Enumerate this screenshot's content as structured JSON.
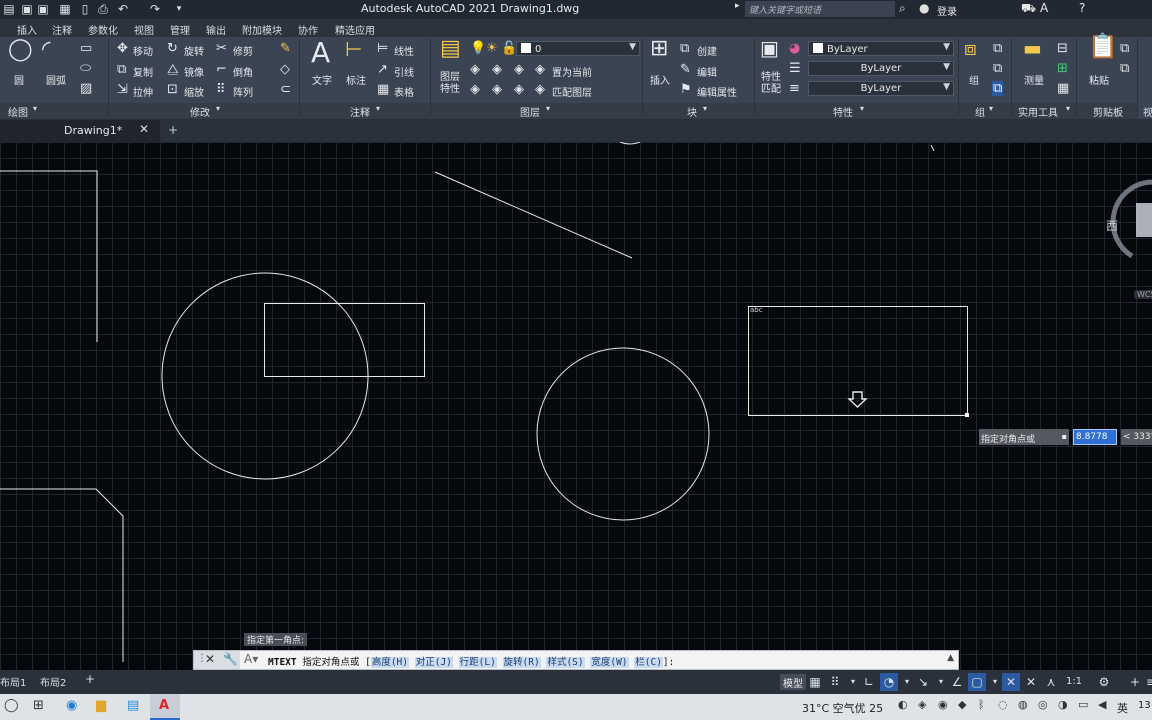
{
  "window": {
    "app_title": "Autodesk AutoCAD 2021    Drawing1.dwg",
    "search_placeholder": "键入关键字或短语",
    "login_label": "登录"
  },
  "ribbon_tabs": [
    "插入",
    "注释",
    "参数化",
    "视图",
    "管理",
    "输出",
    "附加模块",
    "协作",
    "精选应用"
  ],
  "ribbon": {
    "draw": {
      "title": "绘图",
      "circle": "圆",
      "arc": "圆弧"
    },
    "modify": {
      "title": "修改",
      "move": "移动",
      "rotate": "旋转",
      "trim": "修剪",
      "copy": "复制",
      "mirror": "镜像",
      "fillet": "倒角",
      "stretch": "拉伸",
      "scale": "缩放",
      "array": "阵列"
    },
    "annotation": {
      "title": "注释",
      "text": "文字",
      "dimension": "标注",
      "linear": "线性",
      "leader": "引线",
      "table": "表格"
    },
    "layers": {
      "title": "图层",
      "layer_props": "图层\n特性",
      "current_layer": "0",
      "set_current": "置为当前",
      "match_layer": "匹配图层"
    },
    "block": {
      "title": "块",
      "insert": "插入",
      "create": "创建",
      "edit": "编辑",
      "edit_attr": "编辑属性"
    },
    "properties": {
      "title": "特性",
      "match": "特性\n匹配",
      "color": "ByLayer",
      "linetype": "ByLayer",
      "lineweight": "ByLayer"
    },
    "groups": {
      "title": "组",
      "group": "组"
    },
    "utilities": {
      "title": "实用工具",
      "measure": "测量"
    },
    "clipboard": {
      "title": "剪贴板",
      "paste": "粘贴"
    },
    "view_partial": "视"
  },
  "doc_tabs": {
    "active": "Drawing1*"
  },
  "canvas": {
    "mtext_box_label": "abc",
    "viewcube_west": "西",
    "wcs": "WCS"
  },
  "command": {
    "prompt_hint": "指定第一角点:",
    "name": "MTEXT",
    "prompt": "指定对角点或",
    "options": [
      "高度(H)",
      "对正(J)",
      "行距(L)",
      "旋转(R)",
      "样式(S)",
      "宽度(W)",
      "栏(C)"
    ],
    "suffix": "]:"
  },
  "dynamic_input": {
    "label": "指定对角点或",
    "value": "8.8778",
    "angle": "< 333°"
  },
  "layout_tabs": [
    "布局1",
    "布局2"
  ],
  "status_bar": {
    "model": "模型",
    "scale": "1:1"
  },
  "taskbar": {
    "weather": "31°C  空气优 25",
    "ime": "英",
    "clock": "13"
  }
}
